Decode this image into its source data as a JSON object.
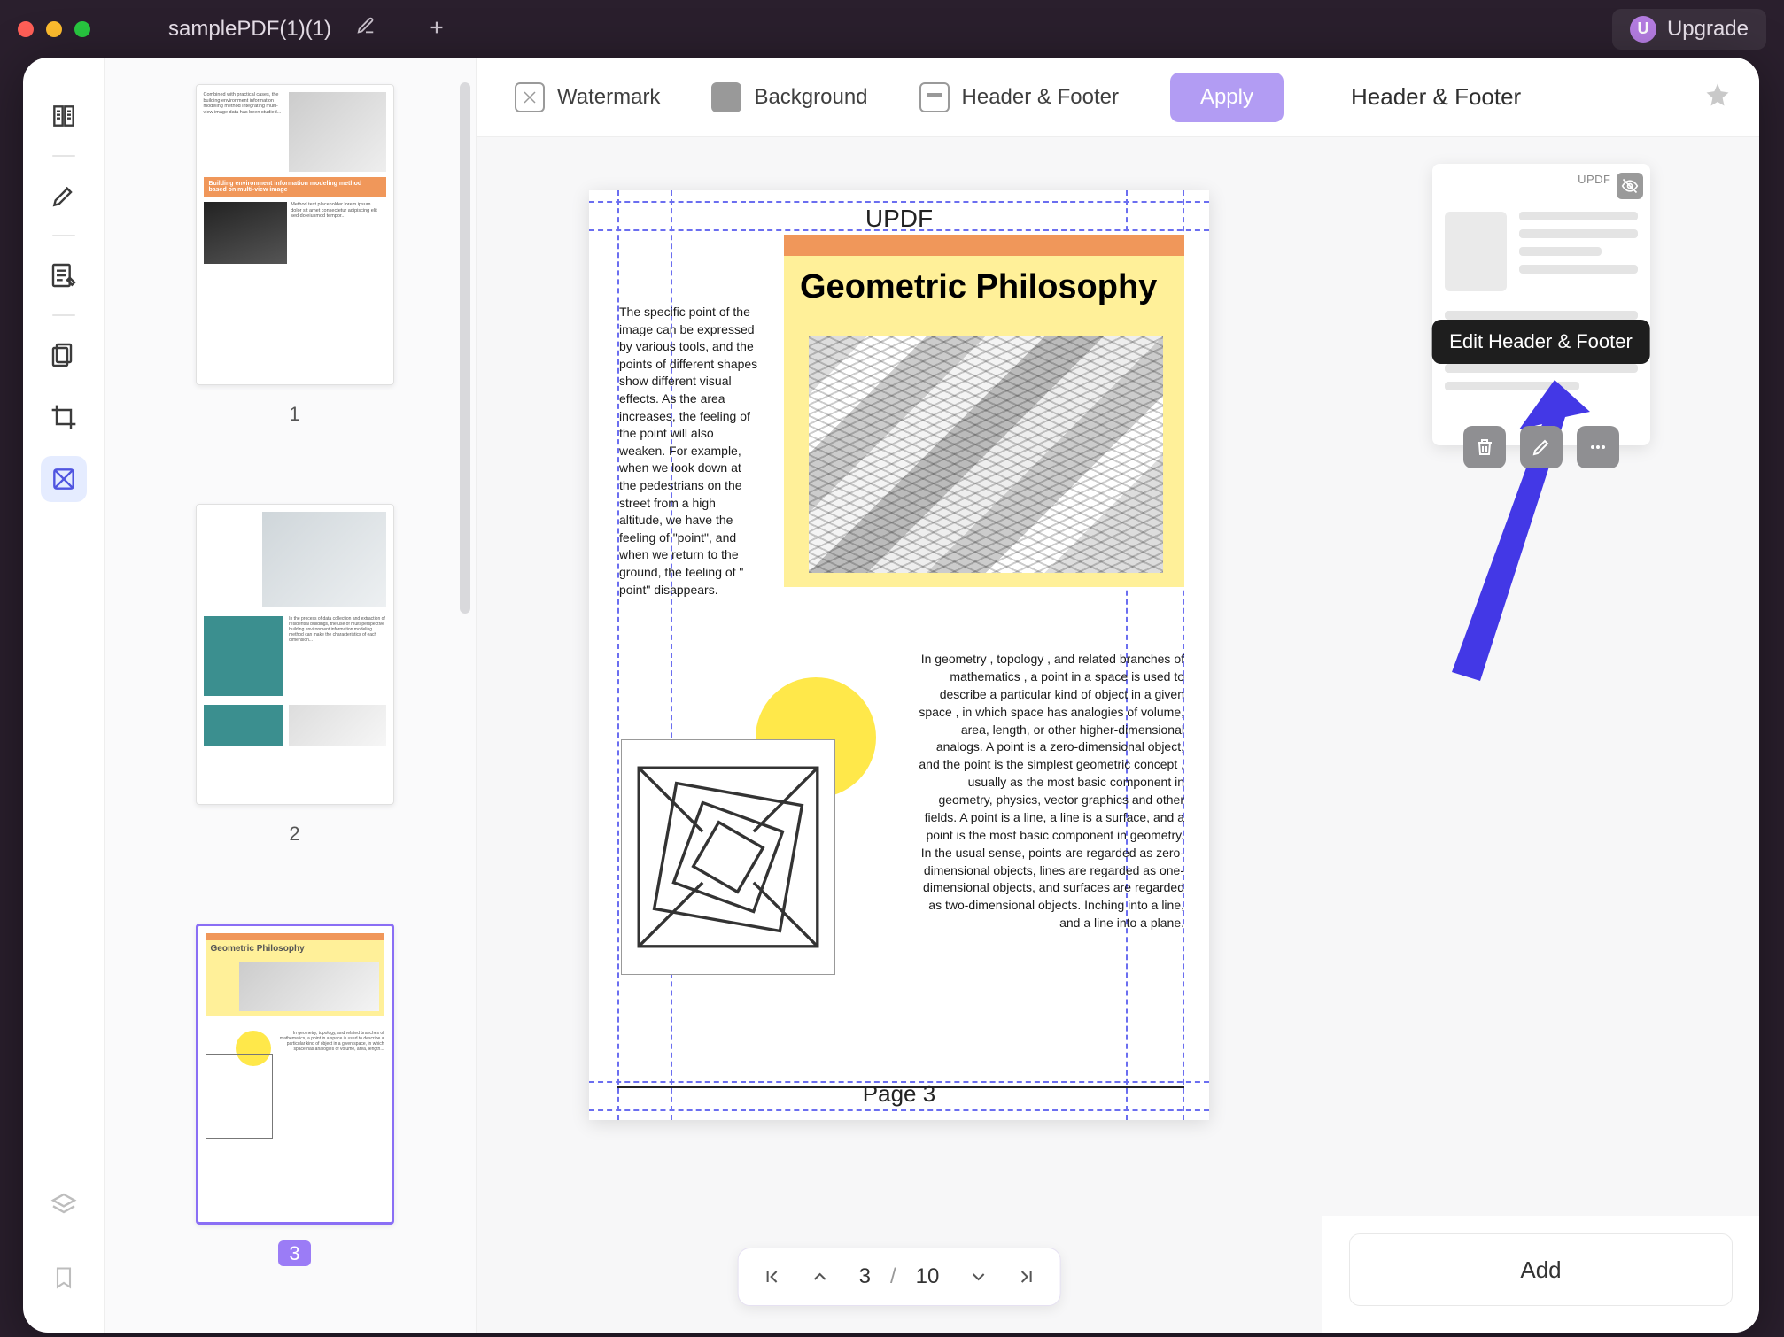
{
  "window": {
    "tab_title": "samplePDF(1)(1)",
    "upgrade_label": "Upgrade",
    "upgrade_badge": "U"
  },
  "toolbar": {
    "watermark_label": "Watermark",
    "background_label": "Background",
    "header_footer_label": "Header & Footer",
    "apply_label": "Apply"
  },
  "thumbnails": {
    "page1_label": "1",
    "page2_label": "2",
    "page3_label": "3",
    "thumb1_banner": "Building environment information modeling method based on multi-view image",
    "thumb3_heading": "Geometric Philosophy"
  },
  "page": {
    "header_text": "UPDF",
    "footer_text": "Page 3",
    "heading": "Geometric Philosophy",
    "left_paragraph": "The specific point of the image can be expressed by various tools, and the points of different shapes show different visual effects. As the area increases, the feeling of the point will also weaken. For example, when we look down at the pedestrians on the street from a high altitude, we have the feeling of \"point\", and when we return to the ground, the feeling of \" point\" disappears.",
    "right_paragraph": "In geometry , topology , and related branches of mathematics , a point in a space is used to describe a particular kind of object in a given space , in which space has analogies of volume, area, length, or other higher-dimensional analogs. A point is a zero-dimensional object, and the point is the simplest geometric concept , usually as the most basic component in geometry, physics, vector graphics and other fields. A point is a line, a line is a surface, and a point is the most basic component in geometry. In the usual sense, points are regarded as zero-dimensional objects, lines are regarded as one-dimensional objects, and surfaces are regarded as two-dimensional objects. Inching into a line, and a line into a plane."
  },
  "nav": {
    "current_page": "3",
    "divider": "/",
    "total_pages": "10"
  },
  "right_panel": {
    "title": "Header & Footer",
    "card_brand": "UPDF",
    "tooltip": "Edit Header & Footer",
    "add_label": "Add"
  },
  "left_rail_icons": {
    "reader": "reader-icon",
    "highlighter": "highlighter-icon",
    "edit": "edit-text-icon",
    "pages": "pages-icon",
    "crop": "crop-icon",
    "watermark": "watermark-tool-icon",
    "layers": "layers-icon",
    "bookmark": "bookmark-icon"
  }
}
